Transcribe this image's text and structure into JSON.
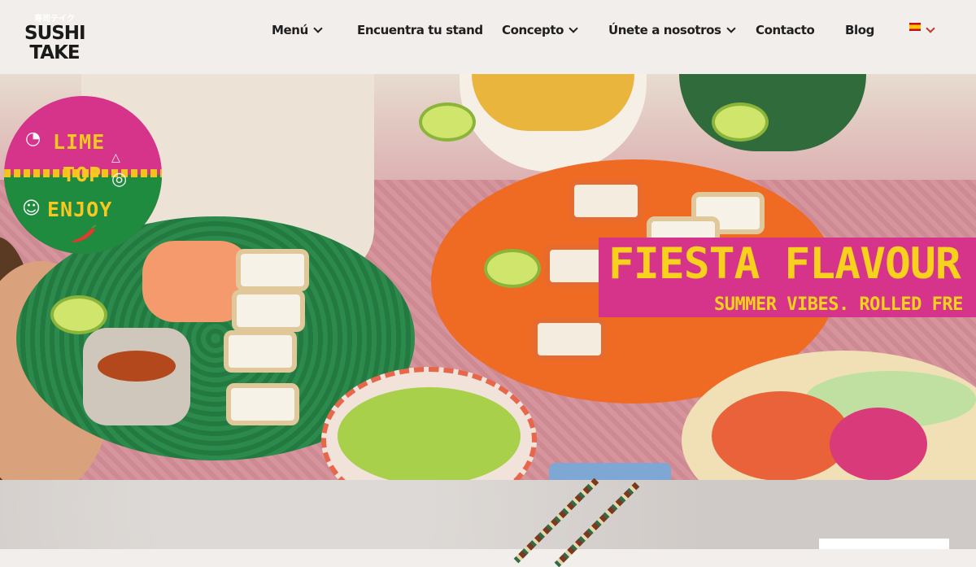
{
  "brand": {
    "logo_japanese": "寿司テイク",
    "logo_line1": "SUSHI",
    "logo_line2": "TAKE"
  },
  "nav": {
    "items": [
      {
        "label": "Menú",
        "has_dropdown": true
      },
      {
        "label": "Encuentra tu stand",
        "has_dropdown": false
      },
      {
        "label": "Concepto",
        "has_dropdown": true
      },
      {
        "label": "Únete a nosotros",
        "has_dropdown": true
      },
      {
        "label": "Contacto",
        "has_dropdown": false
      },
      {
        "label": "Blog",
        "has_dropdown": false
      }
    ],
    "language_flag": "es-flag-icon"
  },
  "hero": {
    "badge": {
      "line1": "LIME",
      "line2": "TOP",
      "line3": "ENJOY",
      "colors": {
        "top": "#d6338a",
        "bottom": "#1e8b3f",
        "text": "#f7c81f"
      }
    },
    "promo": {
      "title": "FIESTA FLAVOUR",
      "subtitle": "SUMMER VIBES. ROLLED FRE",
      "colors": {
        "background": "#d6338a",
        "text": "#f7d11c"
      }
    }
  },
  "colors": {
    "header_bg": "#f1eeeb",
    "text_dark": "#1f1f1f"
  }
}
